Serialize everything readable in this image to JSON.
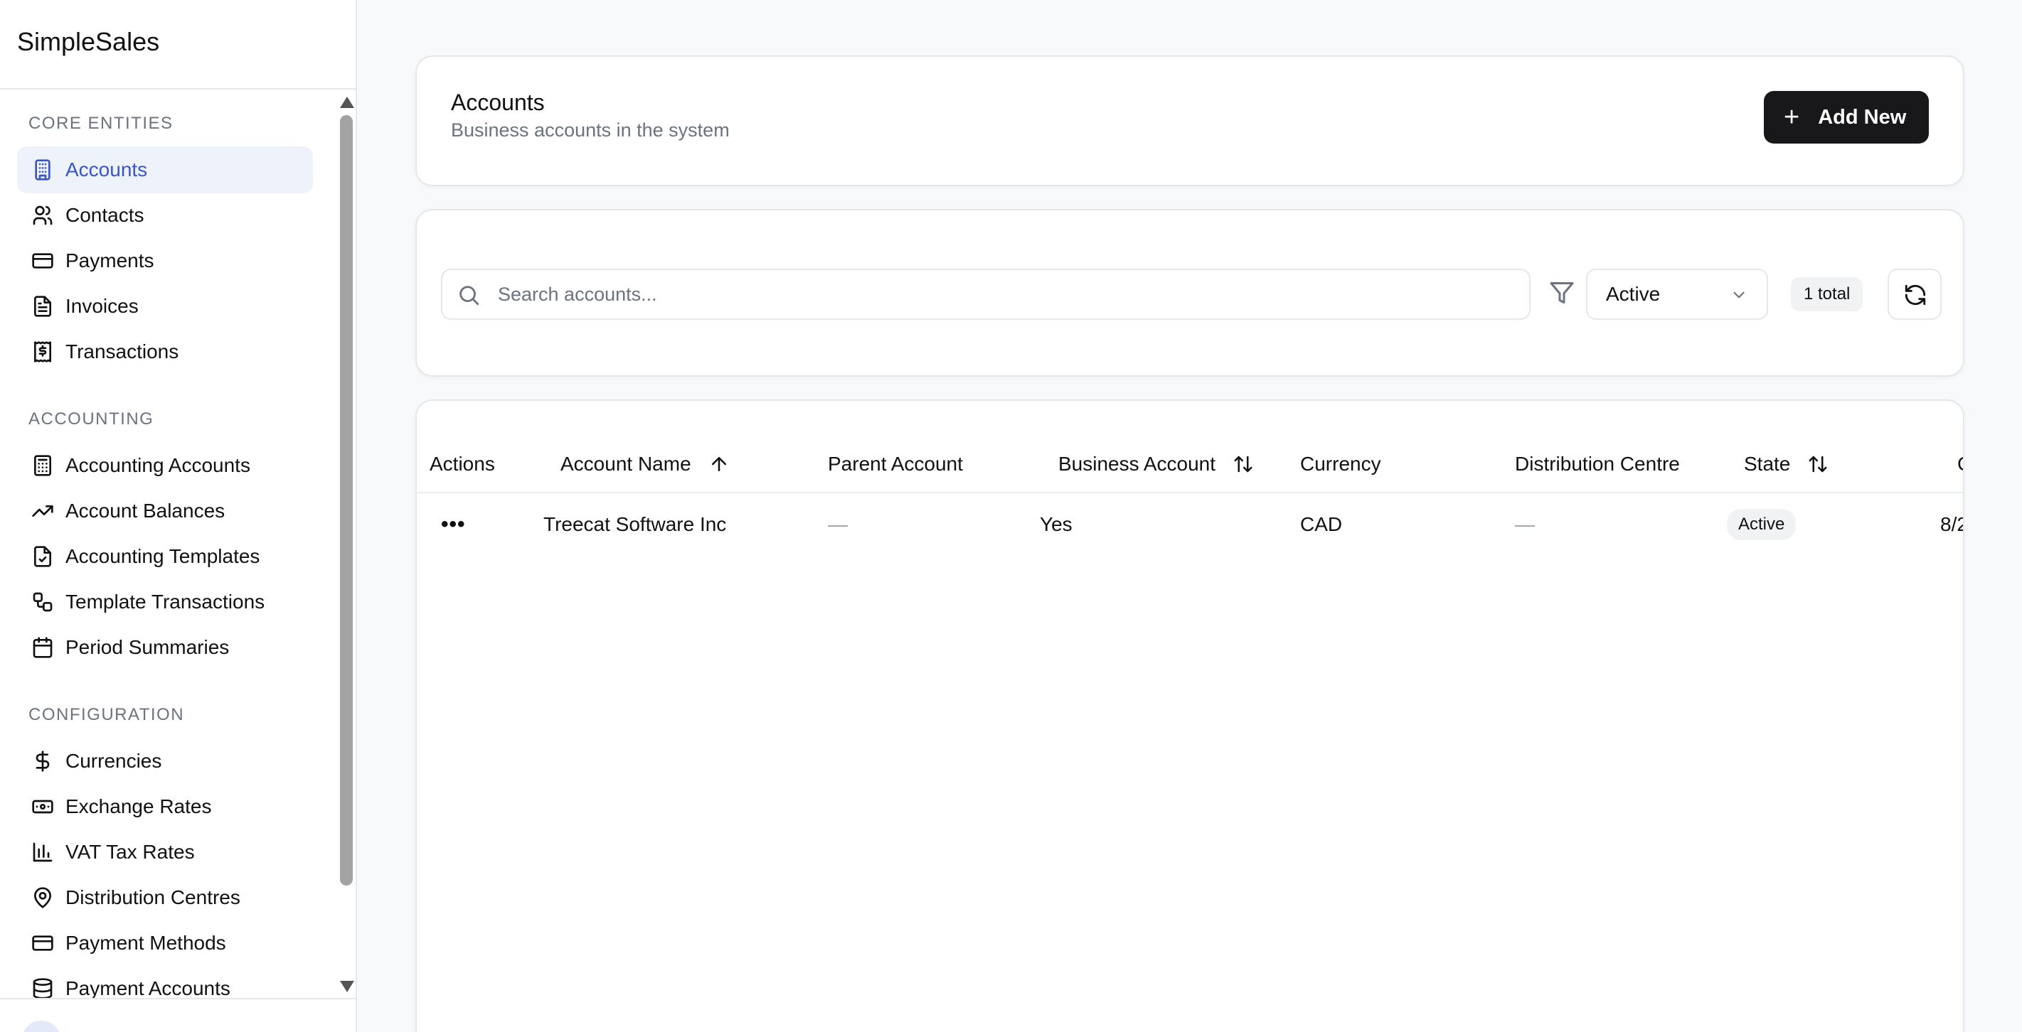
{
  "app": {
    "name": "SimpleSales"
  },
  "sidebar": {
    "sections": [
      {
        "title": "CORE ENTITIES",
        "items": [
          {
            "label": "Accounts",
            "icon": "building-icon",
            "active": true
          },
          {
            "label": "Contacts",
            "icon": "users-icon"
          },
          {
            "label": "Payments",
            "icon": "credit-card-icon"
          },
          {
            "label": "Invoices",
            "icon": "file-text-icon"
          },
          {
            "label": "Transactions",
            "icon": "receipt-dollar-icon"
          }
        ]
      },
      {
        "title": "ACCOUNTING",
        "items": [
          {
            "label": "Accounting Accounts",
            "icon": "calculator-icon"
          },
          {
            "label": "Account Balances",
            "icon": "trending-up-icon"
          },
          {
            "label": "Accounting Templates",
            "icon": "file-check-icon"
          },
          {
            "label": "Template Transactions",
            "icon": "workflow-icon"
          },
          {
            "label": "Period Summaries",
            "icon": "calendar-icon"
          }
        ]
      },
      {
        "title": "CONFIGURATION",
        "items": [
          {
            "label": "Currencies",
            "icon": "dollar-sign-icon"
          },
          {
            "label": "Exchange Rates",
            "icon": "banknote-icon"
          },
          {
            "label": "VAT Tax Rates",
            "icon": "bar-chart-icon"
          },
          {
            "label": "Distribution Centres",
            "icon": "map-pin-icon"
          },
          {
            "label": "Payment Methods",
            "icon": "credit-card-icon"
          },
          {
            "label": "Payment Accounts",
            "icon": "database-icon"
          }
        ]
      }
    ]
  },
  "header": {
    "title": "Accounts",
    "subtitle": "Business accounts in the system",
    "add_button": "Add New"
  },
  "filters": {
    "search_placeholder": "Search accounts...",
    "search_value": "",
    "status_value": "Active",
    "total_label": "1 total"
  },
  "table": {
    "columns": [
      "Actions",
      "Account Name",
      "Parent Account",
      "Business Account",
      "Currency",
      "Distribution Centre",
      "State",
      "C"
    ],
    "rows": [
      {
        "actions": "•••",
        "account_name": "Treecat Software Inc",
        "parent_account": "—",
        "business_account": "Yes",
        "currency": "CAD",
        "distribution_centre": "—",
        "state": "Active",
        "created": "8/2"
      }
    ]
  },
  "colors": {
    "accent": "#3b55c9",
    "active_bg": "#eef2fb",
    "primary_button": "#18181b"
  }
}
